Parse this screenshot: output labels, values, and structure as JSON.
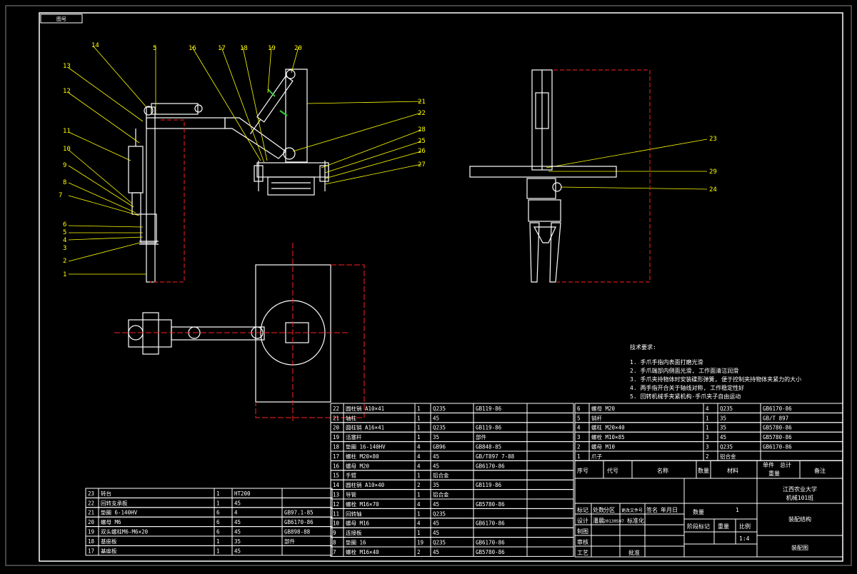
{
  "drawing": {
    "title_stamp": "图号",
    "colors": {
      "background": "#000000",
      "lines": "#ffffff",
      "labels": "#ffff00",
      "red_dashed": "#ff2020",
      "green": "#33cc33"
    }
  },
  "part_labels": {
    "left": [
      "13",
      "12",
      "11",
      "10",
      "9",
      "8",
      "7",
      "6",
      "5",
      "4",
      "3",
      "2",
      "1"
    ],
    "top": [
      "14",
      "5",
      "16",
      "17",
      "18",
      "19",
      "20"
    ],
    "right": [
      "21",
      "22",
      "28",
      "25",
      "26",
      "27"
    ],
    "side_view": [
      "23",
      "29",
      "24"
    ]
  },
  "tech_requirements": {
    "heading": "技术要求:",
    "items": [
      "1. 手爪手指内表面打磨光滑",
      "2. 手爪端部内侧面光滑, 工作面清洁润滑",
      "3. 手爪夹持物体时安装碟形弹簧, 便于控制夹持物体夹紧力的大小",
      "4. 两手指开合关于轴线对称, 工作稳定性好",
      "5. 回转机械手夹紧机构-手爪夹子自由运动"
    ]
  },
  "bom_right": {
    "rows": [
      {
        "no": "22",
        "name": "圆柱销 A10×41",
        "qty": "1",
        "mat": "Q235",
        "std": "GB119-86"
      },
      {
        "no": "21",
        "name": "轴柱",
        "qty": "1",
        "mat": "45",
        "std": ""
      },
      {
        "no": "20",
        "name": "圆柱销 A16×41",
        "qty": "1",
        "mat": "Q235",
        "std": "GB119-86"
      },
      {
        "no": "19",
        "name": "活塞杆",
        "qty": "1",
        "mat": "35",
        "std": "部件"
      },
      {
        "no": "18",
        "name": "垫圈 16-140HV",
        "qty": "4",
        "mat": "GB96",
        "std": "GB848-85"
      },
      {
        "no": "17",
        "name": "螺柱 M20×80",
        "qty": "4",
        "mat": "45",
        "std": "GB/T897 7-88"
      },
      {
        "no": "16",
        "name": "螺母 M20",
        "qty": "4",
        "mat": "45",
        "std": "GB6170-86"
      },
      {
        "no": "15",
        "name": "手臂",
        "qty": "1",
        "mat": "铝合金",
        "std": ""
      },
      {
        "no": "14",
        "name": "圆柱销 A10×40",
        "qty": "2",
        "mat": "35",
        "std": "GB119-86"
      },
      {
        "no": "13",
        "name": "导管",
        "qty": "1",
        "mat": "铝合金",
        "std": ""
      },
      {
        "no": "12",
        "name": "螺栓 M16×70",
        "qty": "4",
        "mat": "45",
        "std": "GB5780-86"
      },
      {
        "no": "11",
        "name": "回转轴",
        "qty": "1",
        "mat": "Q235",
        "std": ""
      },
      {
        "no": "10",
        "name": "螺母 M16",
        "qty": "4",
        "mat": "45",
        "std": "GB6170-86"
      },
      {
        "no": "9",
        "name": "连接板",
        "qty": "1",
        "mat": "45",
        "std": ""
      },
      {
        "no": "8",
        "name": "垫圈 16",
        "qty": "19",
        "mat": "Q235",
        "std": "GB6170-86"
      },
      {
        "no": "7",
        "name": "螺栓 M16×40",
        "qty": "2",
        "mat": "45",
        "std": "GB5780-86"
      }
    ],
    "small_rows": [
      {
        "no": "6",
        "name": "螺母 M20",
        "qty": "4",
        "mat": "Q235",
        "std": "GB6170-86"
      },
      {
        "no": "5",
        "name": "销杆",
        "qty": "1",
        "mat": "35",
        "std": "GB/T 897"
      },
      {
        "no": "4",
        "name": "螺柱 M20×40",
        "qty": "1",
        "mat": "35",
        "std": "GB5780-86"
      },
      {
        "no": "3",
        "name": "螺栓 M10×85",
        "qty": "3",
        "mat": "45",
        "std": "GB5780-86"
      },
      {
        "no": "2",
        "name": "螺母 M10",
        "qty": "3",
        "mat": "Q235",
        "std": "GB6170-86"
      },
      {
        "no": "1",
        "name": "爪子",
        "qty": "2",
        "mat": "铝合金",
        "std": ""
      }
    ],
    "header": {
      "no": "序号",
      "code": "代号",
      "name": "名称",
      "qty": "数量",
      "mat": "材料",
      "unit_wt": "单件",
      "total_wt": "总计",
      "weight": "重量",
      "remark": "备注"
    }
  },
  "bom_left": {
    "rows": [
      {
        "no": "23",
        "name": "转台",
        "qty": "1",
        "mat": "HT200",
        "std": ""
      },
      {
        "no": "22",
        "name": "回转支承板",
        "qty": "1",
        "mat": "45",
        "std": ""
      },
      {
        "no": "21",
        "name": "垫圈 6-140HV",
        "qty": "6",
        "mat": "4",
        "std": "GB97.1-85"
      },
      {
        "no": "20",
        "name": "螺母 M6",
        "qty": "6",
        "mat": "45",
        "std": "GB6170-86"
      },
      {
        "no": "19",
        "name": "双头螺柱M6-M6×20",
        "qty": "6",
        "mat": "45",
        "std": "GB898-88"
      },
      {
        "no": "18",
        "name": "基座板",
        "qty": "1",
        "mat": "35",
        "std": "部件"
      },
      {
        "no": "17",
        "name": "基座板",
        "qty": "1",
        "mat": "45",
        "std": ""
      }
    ]
  },
  "title_block": {
    "school": "江西农业大学",
    "class": "机械101班",
    "drawing_name": "装配结构",
    "scale_label": "比例",
    "scale": "1:4",
    "qty_label": "数量",
    "qty": "1",
    "mark_label": "标记",
    "count_label": "处数",
    "zone_label": "分区",
    "change_label": "更改文件号",
    "sign_label": "签名",
    "date_label": "年月日",
    "design_label": "设计",
    "design_name": "潘晨",
    "design_date": "20130507",
    "std_label": "标准化",
    "check_label": "审核",
    "process_label": "工艺",
    "approve_label": "批准",
    "drafter_label": "制图",
    "stage_label": "阶段标记",
    "weight_label": "重量",
    "sheet": "装配图"
  }
}
